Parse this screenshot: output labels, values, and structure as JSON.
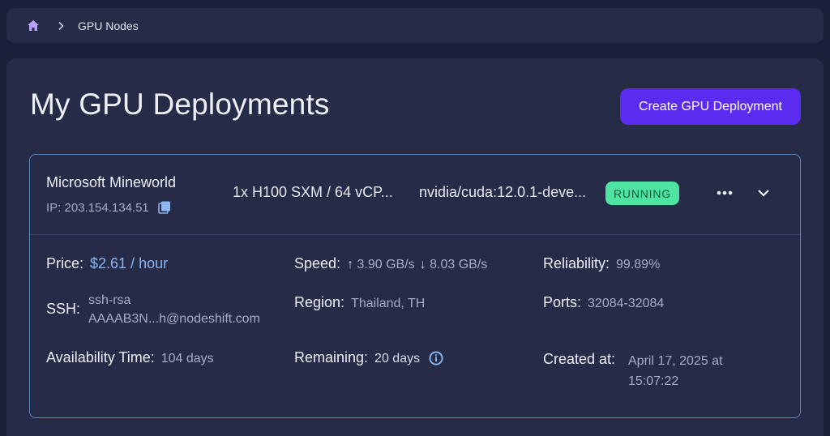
{
  "breadcrumb": {
    "current": "GPU Nodes"
  },
  "page": {
    "title": "My GPU Deployments",
    "create_button": "Create GPU Deployment"
  },
  "deployment": {
    "name": "Microsoft Mineworld",
    "ip": "IP: 203.154.134.51",
    "spec": "1x H100 SXM / 64 vCP...",
    "image": "nvidia/cuda:12.0.1-deve...",
    "status": "RUNNING",
    "details": {
      "price_label": "Price:",
      "price_value": "$2.61 / hour",
      "speed_label": "Speed:",
      "speed_up_icon": "↑",
      "speed_up": "3.90 GB/s",
      "speed_down_icon": "↓",
      "speed_down": "8.03 GB/s",
      "reliability_label": "Reliability:",
      "reliability_value": "99.89%",
      "ssh_label": "SSH:",
      "ssh_line1": "ssh-rsa",
      "ssh_line2": "AAAAB3N...h@nodeshift.com",
      "region_label": "Region:",
      "region_value": "Thailand, TH",
      "ports_label": "Ports:",
      "ports_value": "32084-32084",
      "availability_label": "Availability Time:",
      "availability_value": "104 days",
      "remaining_label": "Remaining:",
      "remaining_value": "20 days",
      "created_label": "Created at:",
      "created_line1": "April 17, 2025 at",
      "created_line2": "15:07:22"
    }
  },
  "colors": {
    "accent": "#5b2cf0",
    "status_bg": "#4ee3a0",
    "price": "#8ab6f4",
    "card_border": "#5a86c0"
  },
  "icons": {
    "home": "home-icon",
    "separator": "chevron-right-icon",
    "copy": "copy-icon",
    "more": "more-horizontal-icon",
    "expand": "chevron-down-icon",
    "info": "info-icon"
  }
}
